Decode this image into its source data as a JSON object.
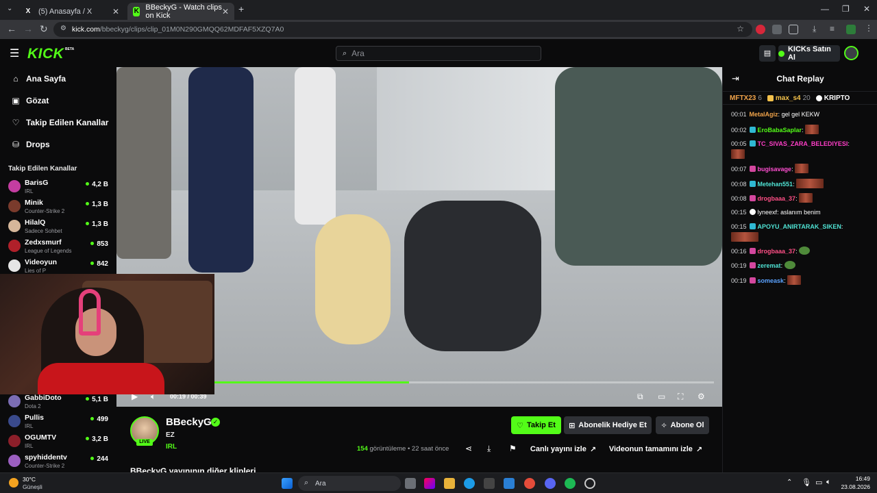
{
  "browser": {
    "tabs": [
      {
        "title": "(5) Anasayfa / X",
        "favicon": "X"
      },
      {
        "title": "BBeckyG - Watch clips on Kick",
        "favicon": "K"
      }
    ],
    "url_host": "kick.com",
    "url_path": "/bbeckyg/clips/clip_01M0N290GMQQ62MDFAF5XZQ7A0"
  },
  "header": {
    "logo": "KICK",
    "logo_tag": "BETA",
    "search_placeholder": "Ara",
    "buy_kicks": "KICKs Satın Al"
  },
  "sidebar": {
    "nav": [
      {
        "label": "Ana Sayfa",
        "icon": "home-icon"
      },
      {
        "label": "Gözat",
        "icon": "browse-icon"
      },
      {
        "label": "Takip Edilen Kanallar",
        "icon": "heart-icon"
      },
      {
        "label": "Drops",
        "icon": "drops-icon"
      }
    ],
    "followed_title": "Takip Edilen Kanallar",
    "channels": [
      {
        "name": "BarisG",
        "category": "IRL",
        "viewers": "4,2 B",
        "color": "#c43da1"
      },
      {
        "name": "Minik",
        "category": "Counter-Strike 2",
        "viewers": "1,3 B",
        "color": "#7a3b2c"
      },
      {
        "name": "HilalQ",
        "category": "Sadece Sohbet",
        "viewers": "1,3 B",
        "color": "#d6b79a"
      },
      {
        "name": "Zedxsmurf",
        "category": "League of Legends",
        "viewers": "853",
        "color": "#b0202a"
      },
      {
        "name": "Videoyun",
        "category": "Lies of P",
        "viewers": "842",
        "color": "#e6e6e6"
      },
      {
        "name": "GabbiDoto",
        "category": "Dota 2",
        "viewers": "5,1 B",
        "color": "#7b6db4"
      },
      {
        "name": "Pullis",
        "category": "IRL",
        "viewers": "499",
        "color": "#3a4a8c"
      },
      {
        "name": "OGUMTV",
        "category": "IRL",
        "viewers": "3,2 B",
        "color": "#8c1f2a"
      },
      {
        "name": "spyhiddentv",
        "category": "Counter-Strike 2",
        "viewers": "244",
        "color": "#9b5fc0"
      }
    ]
  },
  "player": {
    "time_current": "00:19",
    "time_total": "00:39",
    "progress_fraction": 0.39
  },
  "chat": {
    "title": "Chat Replay",
    "leaders": [
      {
        "name": "MFTX23",
        "count": "6",
        "color": "#f0a34a"
      },
      {
        "name": "max_s4",
        "count": "20",
        "color": "#f3c14b"
      },
      {
        "name": "KRIPTO",
        "count": "",
        "color": "#ffffff"
      }
    ],
    "messages": [
      {
        "time": "00:01",
        "user": "MetalAgiz",
        "text": "gel gel KEKW",
        "color": "#f0a34a",
        "badge": ""
      },
      {
        "time": "00:02",
        "user": "EroBabaSaplar",
        "text": "",
        "color": "#53fc18",
        "badge": "#2fb8d2",
        "emote": 20
      },
      {
        "time": "00:05",
        "user": "TC_SIVAS_ZARA_BELEDIYESI",
        "text": "",
        "color": "#ff3ec8",
        "badge": "#2fb8d2",
        "emote": 20
      },
      {
        "time": "00:07",
        "user": "bugisavage",
        "text": "",
        "color": "#ff4fd1",
        "badge": "#d3479e",
        "emote": 20
      },
      {
        "time": "00:08",
        "user": "Metehan551",
        "text": "",
        "color": "#4fe3d4",
        "badge": "#2fb8d2",
        "emote": 40
      },
      {
        "time": "00:08",
        "user": "drogbaaa_37",
        "text": "",
        "color": "#ff4f86",
        "badge": "#d3479e",
        "emote": 20
      },
      {
        "time": "00:15",
        "user": "lyneexf",
        "text": "aslanım benim",
        "color": "#ffffff",
        "badge": "#ffffff"
      },
      {
        "time": "00:15",
        "user": "APOYU_ANIRTARAK_SIKEN",
        "text": "",
        "color": "#4fe3d4",
        "badge": "#2fb8d2",
        "emote": 40
      },
      {
        "time": "00:16",
        "user": "drogbaaa_37",
        "text": "",
        "color": "#ff4f86",
        "badge": "#d3479e",
        "pepe": true
      },
      {
        "time": "00:19",
        "user": "zeremat",
        "text": "",
        "color": "#4fe3d4",
        "badge": "#d3479e",
        "pepe": true
      },
      {
        "time": "00:19",
        "user": "someask",
        "text": "",
        "color": "#5aa2ff",
        "badge": "#d3479e",
        "emote": 20
      }
    ]
  },
  "info": {
    "channel": "BBeckyG",
    "live_badge": "LIVE",
    "clip_title": "EZ",
    "category": "IRL",
    "follow": "Takip Et",
    "gift_sub": "Abonelik Hediye Et",
    "subscribe": "Abone Ol",
    "views_count": "154",
    "views_label": "görüntüleme",
    "posted": "22 saat önce",
    "watch_live": "Canlı yayını izle",
    "watch_full": "Videonun tamamını izle",
    "more_clips": "BBeckyG yayınının diğer klipleri"
  },
  "taskbar": {
    "temp": "30°C",
    "weather": "Güneşli",
    "search": "Ara",
    "time": "16:49",
    "date": "23.08.2026"
  },
  "colors": {
    "accent": "#53fc18",
    "background": "#0b0b0c"
  }
}
